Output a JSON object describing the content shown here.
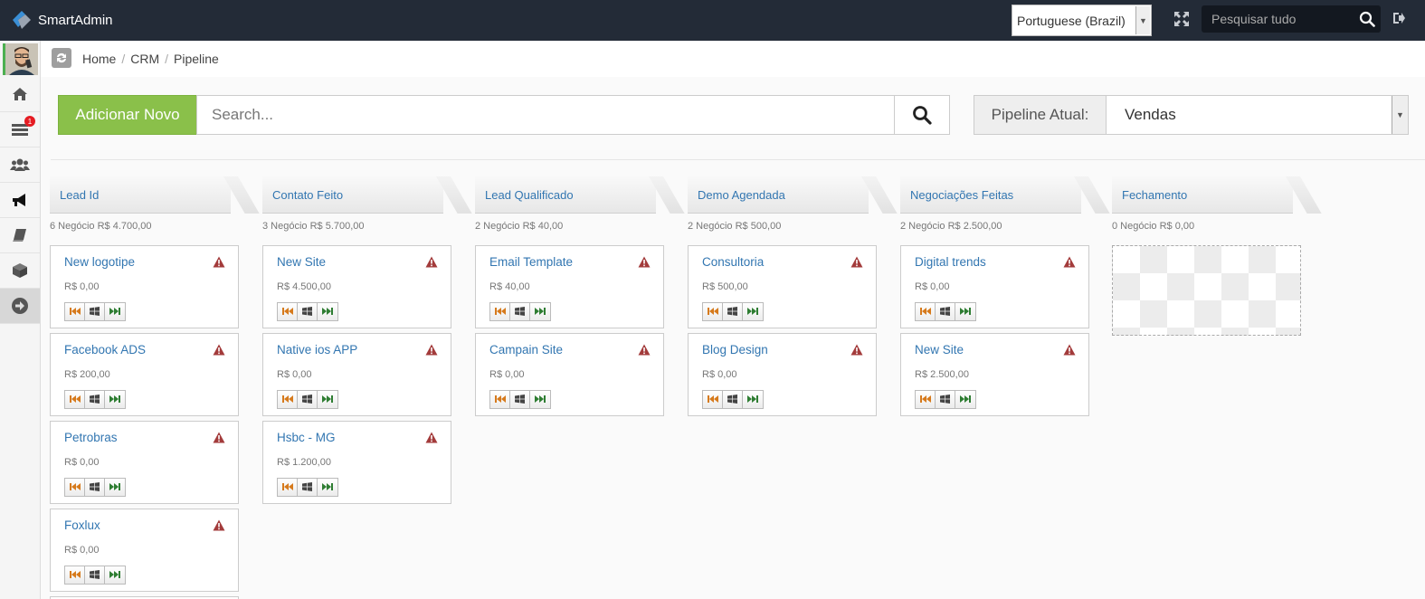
{
  "app": {
    "name": "SmartAdmin",
    "language": "Portuguese (Brazil)",
    "search_placeholder": "Pesquisar tudo"
  },
  "sidebar": {
    "items": [
      {
        "name": "home-icon"
      },
      {
        "name": "list-icon",
        "badge": "1"
      },
      {
        "name": "users-icon"
      },
      {
        "name": "megaphone-icon"
      },
      {
        "name": "book-icon"
      },
      {
        "name": "cube-icon"
      },
      {
        "name": "arrow-circle-right-icon"
      }
    ]
  },
  "breadcrumb": [
    "Home",
    "CRM",
    "Pipeline"
  ],
  "toolbar": {
    "add_label": "Adicionar Novo",
    "search_placeholder": "Search...",
    "pipeline_label": "Pipeline Atual:",
    "pipeline_value": "Vendas"
  },
  "stages": [
    {
      "title": "Lead Id",
      "summary": "6 Negócio R$ 4.700,00",
      "more": true,
      "cards": [
        {
          "title": "New logotipe",
          "value": "R$ 0,00"
        },
        {
          "title": "Facebook ADS",
          "value": "R$ 200,00"
        },
        {
          "title": "Petrobras",
          "value": "R$ 0,00"
        },
        {
          "title": "Foxlux",
          "value": "R$ 0,00"
        }
      ]
    },
    {
      "title": "Contato Feito",
      "summary": "3 Negócio R$ 5.700,00",
      "cards": [
        {
          "title": "New Site",
          "value": "R$ 4.500,00"
        },
        {
          "title": "Native ios APP",
          "value": "R$ 0,00"
        },
        {
          "title": "Hsbc - MG",
          "value": "R$ 1.200,00"
        }
      ]
    },
    {
      "title": "Lead Qualificado",
      "summary": "2 Negócio R$ 40,00",
      "cards": [
        {
          "title": "Email Template",
          "value": "R$ 40,00"
        },
        {
          "title": "Campain Site",
          "value": "R$ 0,00"
        }
      ]
    },
    {
      "title": "Demo Agendada",
      "summary": "2 Negócio R$ 500,00",
      "cards": [
        {
          "title": "Consultoria",
          "value": "R$ 500,00"
        },
        {
          "title": "Blog Design",
          "value": "R$ 0,00"
        }
      ]
    },
    {
      "title": "Negociações Feitas",
      "summary": "2 Negócio R$ 2.500,00",
      "cards": [
        {
          "title": "Digital trends",
          "value": "R$ 0,00"
        },
        {
          "title": "New Site",
          "value": "R$ 2.500,00"
        }
      ]
    },
    {
      "title": "Fechamento",
      "summary": "0 Negócio R$ 0,00",
      "empty": true,
      "cards": []
    }
  ],
  "colors": {
    "header_bg": "#232b37",
    "add_button": "#8ac04a",
    "link": "#3276b1",
    "warning": "#a33b3b",
    "badge": "#e51c23"
  }
}
